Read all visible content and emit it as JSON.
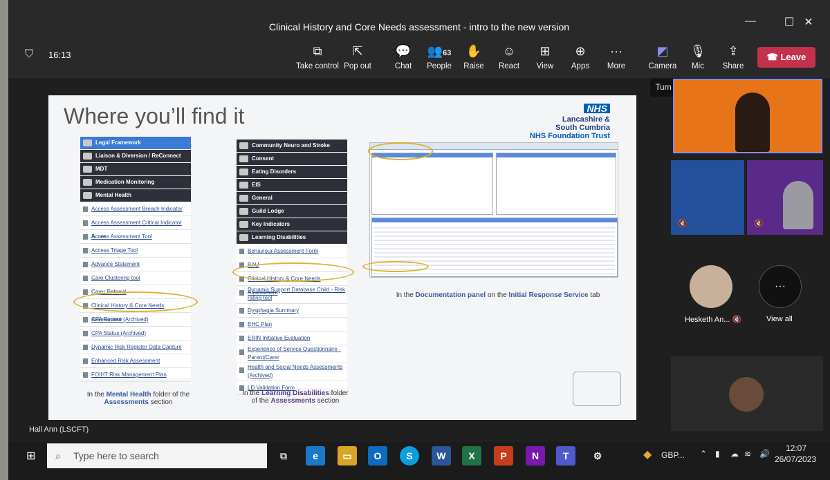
{
  "window": {
    "title": "Clinical History and Core Needs assessment - intro to the new version",
    "minimize": "—",
    "maximize": "☐",
    "close": "✕"
  },
  "toolbar": {
    "time": "16:13",
    "items": [
      {
        "label": "Take control",
        "icon": "take-control-icon",
        "glyph": "⧉"
      },
      {
        "label": "Pop out",
        "icon": "pop-out-icon",
        "glyph": "⇱"
      },
      {
        "label": "Chat",
        "icon": "chat-icon",
        "glyph": "💬"
      },
      {
        "label": "People",
        "icon": "people-icon",
        "glyph": "👥"
      },
      {
        "label": "Raise",
        "icon": "raise-hand-icon",
        "glyph": "✋"
      },
      {
        "label": "React",
        "icon": "react-icon",
        "glyph": "☺"
      },
      {
        "label": "View",
        "icon": "view-icon",
        "glyph": "⊞"
      },
      {
        "label": "Apps",
        "icon": "apps-icon",
        "glyph": "⊕"
      },
      {
        "label": "More",
        "icon": "more-icon",
        "glyph": "···"
      },
      {
        "label": "Camera",
        "icon": "camera-off-icon",
        "glyph": "◩"
      },
      {
        "label": "Mic",
        "icon": "mic-off-icon",
        "glyph": "🎙"
      },
      {
        "label": "Share",
        "icon": "share-icon",
        "glyph": "⇪"
      }
    ],
    "people_count": "63",
    "leave_label": "Leave",
    "tooltip": "Turn camera on (Ctrl+Shift+O)"
  },
  "slide": {
    "title": "Where you’ll find it",
    "nhs_logo": "NHS",
    "org_line1": "Lancashire &",
    "org_line2": "South Cumbria",
    "org_line3": "NHS Foundation Trust",
    "panel1": {
      "folders": [
        "Legal Framework",
        "Liaison & Diversion / ReConnect",
        "MDT",
        "Medication Monitoring",
        "Mental Health"
      ],
      "links": [
        "Access Assessment Breach Indicator",
        "Access Assessment Critical Indicator Score",
        "Access Assessment Tool",
        "Access Triage Tool",
        "Advance Statement",
        "Care Clustering tool",
        "Carer Referral",
        "Clinical History & Core Needs Assessment",
        "CPA Review (Archived)",
        "CPA Status (Archived)",
        "Dynamic Risk Register Data Capture",
        "Enhanced Risk Assessment",
        "FOIHT Risk Management Plan"
      ],
      "caption_pre": "In the ",
      "caption_bold": "Mental Health",
      "caption_mid": " folder of the",
      "caption_bold2": "Assessments",
      "caption_post": " section"
    },
    "panel2": {
      "folders": [
        "Community Neuro and Stroke",
        "Consent",
        "Eating Disorders",
        "EIS",
        "General",
        "Guild Lodge",
        "Key Indicators",
        "Learning Disabilities"
      ],
      "links": [
        "Behaviour Assessment Form",
        "BAU",
        "Clinical History & Core Needs Assessment",
        "Dynamic Support Database Child - Risk rating tool",
        "Dysphagia Summary",
        "EHC Plan",
        "ERIN Initiative Evaluation",
        "Experience of Service Questionnaire - Parent/Carer",
        "Health and Social Needs Assessments (Archived)",
        "LD Validation Form"
      ],
      "caption_pre": "In the ",
      "caption_bold": "Learning Disabilities",
      "caption_mid": " folder",
      "caption_bold2": "Assessments",
      "caption_post": " section"
    },
    "panel3": {
      "caption_pre": "In the ",
      "caption_bold": "Documentation panel",
      "caption_mid": " on the ",
      "caption_bold2": "Initial Response Service",
      "caption_post": " tab"
    }
  },
  "gallery": {
    "self_name": "Hesketh An...",
    "view_all": "View all",
    "more": "···"
  },
  "presenter_name": "Hall Ann (LSCFT)",
  "taskbar": {
    "search_placeholder": "Type here to search",
    "currency": "GBP...",
    "clock_time": "12:07",
    "clock_date": "26/07/2023",
    "apps": [
      "O",
      "S",
      "W",
      "X",
      "P",
      "N",
      "T"
    ]
  }
}
